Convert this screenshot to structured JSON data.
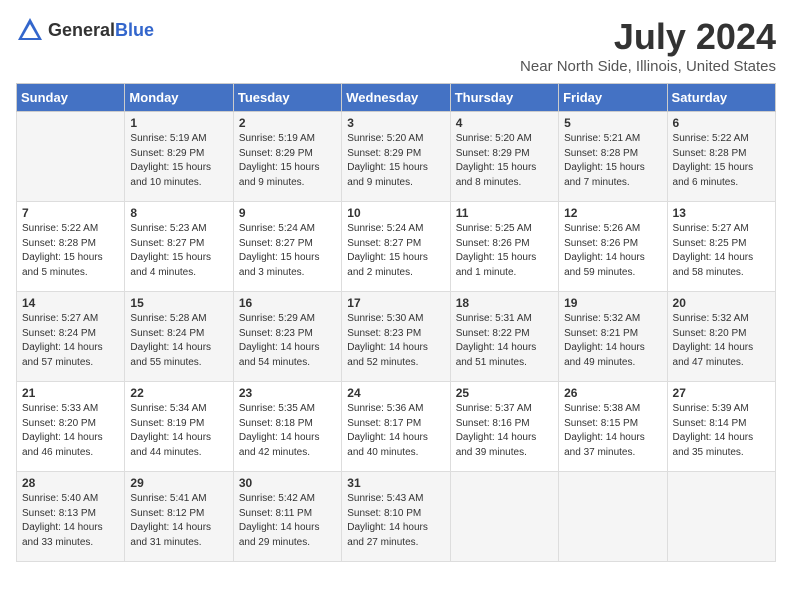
{
  "header": {
    "logo_general": "General",
    "logo_blue": "Blue",
    "title": "July 2024",
    "subtitle": "Near North Side, Illinois, United States"
  },
  "days_of_week": [
    "Sunday",
    "Monday",
    "Tuesday",
    "Wednesday",
    "Thursday",
    "Friday",
    "Saturday"
  ],
  "weeks": [
    [
      {
        "day": "",
        "content": ""
      },
      {
        "day": "1",
        "content": "Sunrise: 5:19 AM\nSunset: 8:29 PM\nDaylight: 15 hours\nand 10 minutes."
      },
      {
        "day": "2",
        "content": "Sunrise: 5:19 AM\nSunset: 8:29 PM\nDaylight: 15 hours\nand 9 minutes."
      },
      {
        "day": "3",
        "content": "Sunrise: 5:20 AM\nSunset: 8:29 PM\nDaylight: 15 hours\nand 9 minutes."
      },
      {
        "day": "4",
        "content": "Sunrise: 5:20 AM\nSunset: 8:29 PM\nDaylight: 15 hours\nand 8 minutes."
      },
      {
        "day": "5",
        "content": "Sunrise: 5:21 AM\nSunset: 8:28 PM\nDaylight: 15 hours\nand 7 minutes."
      },
      {
        "day": "6",
        "content": "Sunrise: 5:22 AM\nSunset: 8:28 PM\nDaylight: 15 hours\nand 6 minutes."
      }
    ],
    [
      {
        "day": "7",
        "content": "Sunrise: 5:22 AM\nSunset: 8:28 PM\nDaylight: 15 hours\nand 5 minutes."
      },
      {
        "day": "8",
        "content": "Sunrise: 5:23 AM\nSunset: 8:27 PM\nDaylight: 15 hours\nand 4 minutes."
      },
      {
        "day": "9",
        "content": "Sunrise: 5:24 AM\nSunset: 8:27 PM\nDaylight: 15 hours\nand 3 minutes."
      },
      {
        "day": "10",
        "content": "Sunrise: 5:24 AM\nSunset: 8:27 PM\nDaylight: 15 hours\nand 2 minutes."
      },
      {
        "day": "11",
        "content": "Sunrise: 5:25 AM\nSunset: 8:26 PM\nDaylight: 15 hours\nand 1 minute."
      },
      {
        "day": "12",
        "content": "Sunrise: 5:26 AM\nSunset: 8:26 PM\nDaylight: 14 hours\nand 59 minutes."
      },
      {
        "day": "13",
        "content": "Sunrise: 5:27 AM\nSunset: 8:25 PM\nDaylight: 14 hours\nand 58 minutes."
      }
    ],
    [
      {
        "day": "14",
        "content": "Sunrise: 5:27 AM\nSunset: 8:24 PM\nDaylight: 14 hours\nand 57 minutes."
      },
      {
        "day": "15",
        "content": "Sunrise: 5:28 AM\nSunset: 8:24 PM\nDaylight: 14 hours\nand 55 minutes."
      },
      {
        "day": "16",
        "content": "Sunrise: 5:29 AM\nSunset: 8:23 PM\nDaylight: 14 hours\nand 54 minutes."
      },
      {
        "day": "17",
        "content": "Sunrise: 5:30 AM\nSunset: 8:23 PM\nDaylight: 14 hours\nand 52 minutes."
      },
      {
        "day": "18",
        "content": "Sunrise: 5:31 AM\nSunset: 8:22 PM\nDaylight: 14 hours\nand 51 minutes."
      },
      {
        "day": "19",
        "content": "Sunrise: 5:32 AM\nSunset: 8:21 PM\nDaylight: 14 hours\nand 49 minutes."
      },
      {
        "day": "20",
        "content": "Sunrise: 5:32 AM\nSunset: 8:20 PM\nDaylight: 14 hours\nand 47 minutes."
      }
    ],
    [
      {
        "day": "21",
        "content": "Sunrise: 5:33 AM\nSunset: 8:20 PM\nDaylight: 14 hours\nand 46 minutes."
      },
      {
        "day": "22",
        "content": "Sunrise: 5:34 AM\nSunset: 8:19 PM\nDaylight: 14 hours\nand 44 minutes."
      },
      {
        "day": "23",
        "content": "Sunrise: 5:35 AM\nSunset: 8:18 PM\nDaylight: 14 hours\nand 42 minutes."
      },
      {
        "day": "24",
        "content": "Sunrise: 5:36 AM\nSunset: 8:17 PM\nDaylight: 14 hours\nand 40 minutes."
      },
      {
        "day": "25",
        "content": "Sunrise: 5:37 AM\nSunset: 8:16 PM\nDaylight: 14 hours\nand 39 minutes."
      },
      {
        "day": "26",
        "content": "Sunrise: 5:38 AM\nSunset: 8:15 PM\nDaylight: 14 hours\nand 37 minutes."
      },
      {
        "day": "27",
        "content": "Sunrise: 5:39 AM\nSunset: 8:14 PM\nDaylight: 14 hours\nand 35 minutes."
      }
    ],
    [
      {
        "day": "28",
        "content": "Sunrise: 5:40 AM\nSunset: 8:13 PM\nDaylight: 14 hours\nand 33 minutes."
      },
      {
        "day": "29",
        "content": "Sunrise: 5:41 AM\nSunset: 8:12 PM\nDaylight: 14 hours\nand 31 minutes."
      },
      {
        "day": "30",
        "content": "Sunrise: 5:42 AM\nSunset: 8:11 PM\nDaylight: 14 hours\nand 29 minutes."
      },
      {
        "day": "31",
        "content": "Sunrise: 5:43 AM\nSunset: 8:10 PM\nDaylight: 14 hours\nand 27 minutes."
      },
      {
        "day": "",
        "content": ""
      },
      {
        "day": "",
        "content": ""
      },
      {
        "day": "",
        "content": ""
      }
    ]
  ]
}
